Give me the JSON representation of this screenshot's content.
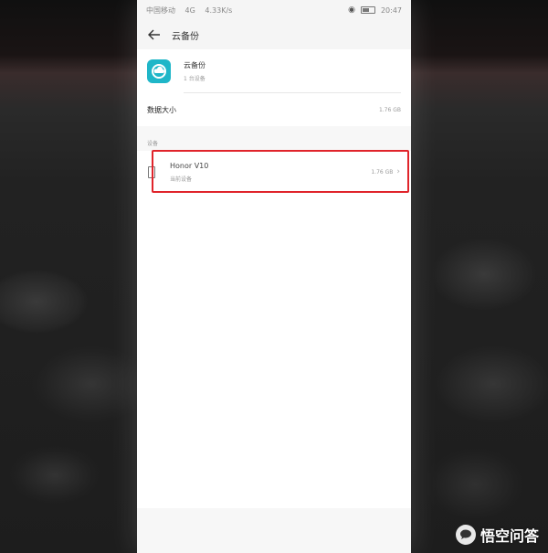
{
  "status_bar": {
    "carrier": "中国移动",
    "network": "4G",
    "speed": "4.33K/s",
    "time": "20:47"
  },
  "header": {
    "title": "云备份"
  },
  "app": {
    "name": "云备份",
    "subtitle": "1 台设备"
  },
  "data_size": {
    "label": "数据大小",
    "value": "1.76 GB"
  },
  "devices_section": {
    "label": "设备"
  },
  "device": {
    "name": "Honor V10",
    "subtitle": "当前设备",
    "size": "1.76 GB"
  },
  "watermark": {
    "text": "悟空问答"
  },
  "colors": {
    "app_icon": "#1fb6c8",
    "highlight": "#e0242b"
  }
}
